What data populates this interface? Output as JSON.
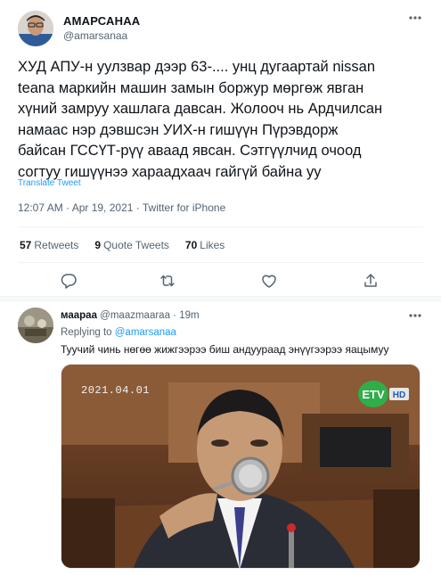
{
  "tweet": {
    "author_name": "АМАРСАНАА",
    "author_handle": "@amarsanaa",
    "more_icon": "more-horizontal-icon",
    "text_lines": [
      "ХУД  АПУ-н уулзвар дээр 63-.... унц дугаартай nissan",
      "teana маркийн машин замын боржур мөргөж явган",
      "хүний замруу хашлага давсан. Жолооч нь Ардчилсан",
      "намаас нэр дэвшсэн УИХ-н гишүүн Пүрэвдорж",
      "байсан  ГССҮТ-рүү аваад явсан. Сэтгүүлчид очоод",
      "согтуу гишүүнээ харaадхаач гайгүй байна уу"
    ],
    "translate_label": "Translate Tweet",
    "timestamp": "12:07 AM · Apr 19, 2021 · Twitter for iPhone",
    "stats": {
      "retweets_count": "57",
      "retweets_label": "Retweets",
      "quotes_count": "9",
      "quotes_label": "Quote Tweets",
      "likes_count": "70",
      "likes_label": "Likes"
    },
    "actions": [
      "reply-icon",
      "retweet-icon",
      "like-icon",
      "share-icon"
    ]
  },
  "reply": {
    "author_name": "маараа",
    "author_handle": "@maazmaaraa",
    "time": "19m",
    "replying_prefix": "Replying to",
    "replying_handle": "@amarsanaa",
    "text": "Туучий чинь нөгөө жижгээрээ биш андуураад энүүгээрээ яацымуу",
    "media": {
      "date_overlay": "2021.04.01",
      "channel_logo_text": "ETV",
      "channel_logo_sub": "HD"
    }
  },
  "colors": {
    "accent": "#1d9bf0",
    "text_primary": "#0f1419",
    "text_secondary": "#536471",
    "divider": "#eff3f4"
  }
}
